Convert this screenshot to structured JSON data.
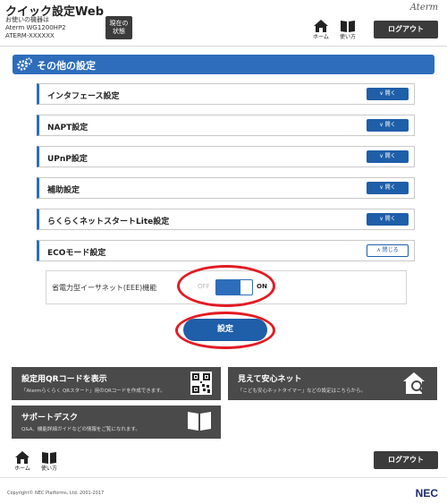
{
  "header": {
    "app_title": "クイック設定Web",
    "device_lines": [
      "お使いの機器は",
      "Aterm WG1200HP2",
      "ATERM-XXXXXX"
    ],
    "status_button": [
      "現在の",
      "状態"
    ],
    "brand": "Aterm",
    "nav": {
      "home": "ホーム",
      "manual": "使い方"
    },
    "logout": "ログアウト"
  },
  "page": {
    "title": "その他の設定"
  },
  "sections": [
    {
      "label": "インタフェース設定",
      "button": "開く"
    },
    {
      "label": "NAPT設定",
      "button": "開く"
    },
    {
      "label": "UPnP設定",
      "button": "開く"
    },
    {
      "label": "補助設定",
      "button": "開く"
    },
    {
      "label": "らくらくネットスタートLite設定",
      "button": "開く"
    },
    {
      "label": "ECOモード設定",
      "button": "閉じる"
    }
  ],
  "eco": {
    "feature_label": "省電力型イーサネット(EEE)機能",
    "off_label": "OFF",
    "on_label": "ON",
    "state": "ON"
  },
  "set_button": "設定",
  "panels": {
    "qr": {
      "title": "設定用QRコードを表示",
      "desc": "「Atermらくらく QRスタート」用のQRコードを作成できます。"
    },
    "safe": {
      "title": "見えて安心ネット",
      "desc": "「こども安心ネットタイマー」などの設定はこちらから。"
    },
    "support": {
      "title": "サポートデスク",
      "desc": "Q&A、機能詳細ガイドなどの情報をご覧になれます。"
    }
  },
  "footer": {
    "nav": {
      "home": "ホーム",
      "manual": "使い方"
    },
    "logout": "ログアウト",
    "copyright": "Copyright© NEC Platforms, Ltd. 2001-2017",
    "brand": "NEC"
  },
  "colors": {
    "accent": "#2d6dbb",
    "highlight": "#e31b23",
    "dark": "#3b3b3b"
  }
}
